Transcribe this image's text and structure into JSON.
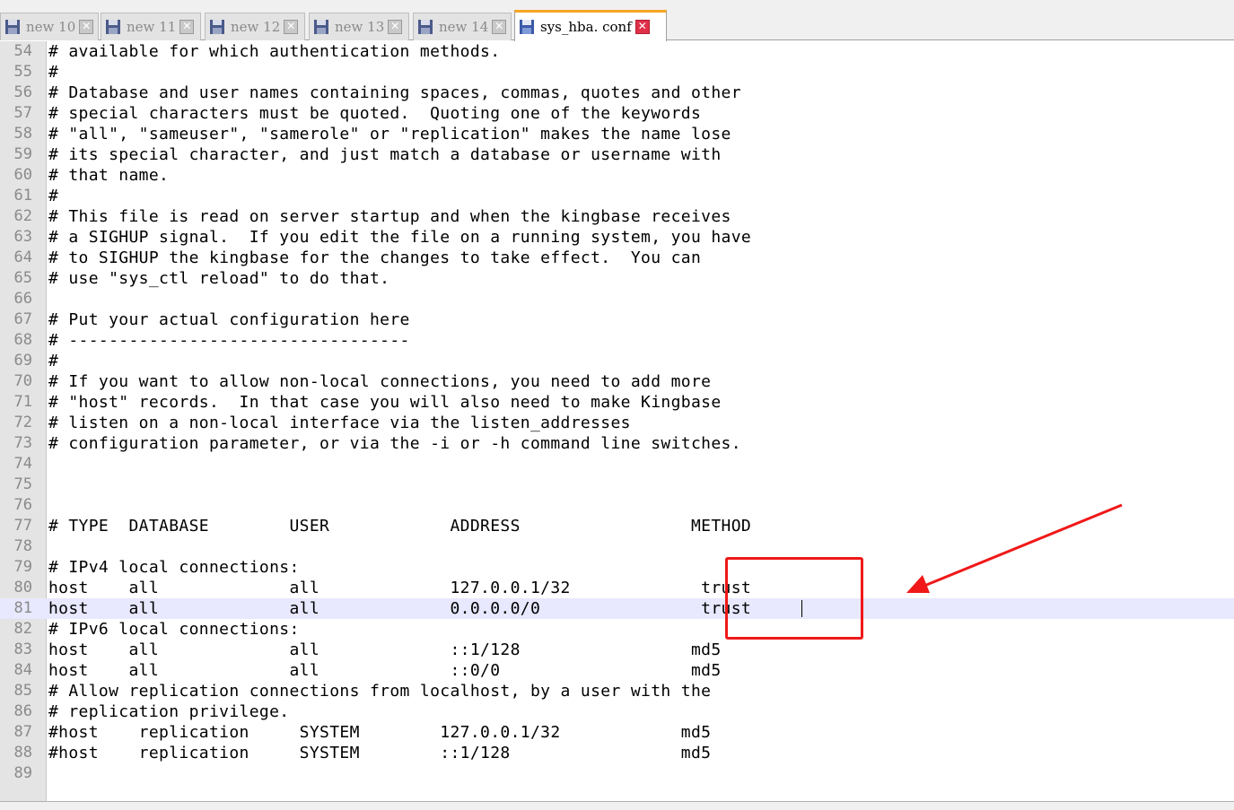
{
  "tabs": [
    {
      "label": "new  10",
      "active": false
    },
    {
      "label": "new  11",
      "active": false
    },
    {
      "label": "new  12",
      "active": false
    },
    {
      "label": "new  13",
      "active": false
    },
    {
      "label": "new  14",
      "active": false
    },
    {
      "label": "sys_hba. conf",
      "active": true
    }
  ],
  "icons": {
    "tab": "floppy-disk-icon",
    "close": "close-icon",
    "annotation": "red-arrow-icon"
  },
  "colors": {
    "current_line": "#e8e8ff",
    "annotation": "#f01818",
    "active_tab_accent": "#f6a623"
  },
  "editor": {
    "current_line_number": "81",
    "lines": [
      {
        "num": "54",
        "text": "# available for which authentication methods."
      },
      {
        "num": "55",
        "text": "#"
      },
      {
        "num": "56",
        "text": "# Database and user names containing spaces, commas, quotes and other"
      },
      {
        "num": "57",
        "text": "# special characters must be quoted.  Quoting one of the keywords"
      },
      {
        "num": "58",
        "text": "# \"all\", \"sameuser\", \"samerole\" or \"replication\" makes the name lose"
      },
      {
        "num": "59",
        "text": "# its special character, and just match a database or username with"
      },
      {
        "num": "60",
        "text": "# that name."
      },
      {
        "num": "61",
        "text": "#"
      },
      {
        "num": "62",
        "text": "# This file is read on server startup and when the kingbase receives"
      },
      {
        "num": "63",
        "text": "# a SIGHUP signal.  If you edit the file on a running system, you have"
      },
      {
        "num": "64",
        "text": "# to SIGHUP the kingbase for the changes to take effect.  You can"
      },
      {
        "num": "65",
        "text": "# use \"sys_ctl reload\" to do that."
      },
      {
        "num": "66",
        "text": ""
      },
      {
        "num": "67",
        "text": "# Put your actual configuration here"
      },
      {
        "num": "68",
        "text": "# ----------------------------------"
      },
      {
        "num": "69",
        "text": "#"
      },
      {
        "num": "70",
        "text": "# If you want to allow non-local connections, you need to add more"
      },
      {
        "num": "71",
        "text": "# \"host\" records.  In that case you will also need to make Kingbase"
      },
      {
        "num": "72",
        "text": "# listen on a non-local interface via the listen_addresses"
      },
      {
        "num": "73",
        "text": "# configuration parameter, or via the -i or -h command line switches."
      },
      {
        "num": "74",
        "text": ""
      },
      {
        "num": "75",
        "text": ""
      },
      {
        "num": "76",
        "text": ""
      },
      {
        "num": "77",
        "text": "# TYPE  DATABASE        USER            ADDRESS                 METHOD"
      },
      {
        "num": "78",
        "text": ""
      },
      {
        "num": "79",
        "text": "# IPv4 local connections:"
      },
      {
        "num": "80",
        "text": "host    all             all             127.0.0.1/32             trust"
      },
      {
        "num": "81",
        "text": "host    all             all             0.0.0.0/0                trust"
      },
      {
        "num": "82",
        "text": "# IPv6 local connections:"
      },
      {
        "num": "83",
        "text": "host    all             all             ::1/128                 md5"
      },
      {
        "num": "84",
        "text": "host    all             all             ::0/0                   md5"
      },
      {
        "num": "85",
        "text": "# Allow replication connections from localhost, by a user with the"
      },
      {
        "num": "86",
        "text": "# replication privilege."
      },
      {
        "num": "87",
        "text": "#host    replication     SYSTEM        127.0.0.1/32            md5"
      },
      {
        "num": "88",
        "text": "#host    replication     SYSTEM        ::1/128                 md5"
      },
      {
        "num": "89",
        "text": ""
      }
    ]
  }
}
